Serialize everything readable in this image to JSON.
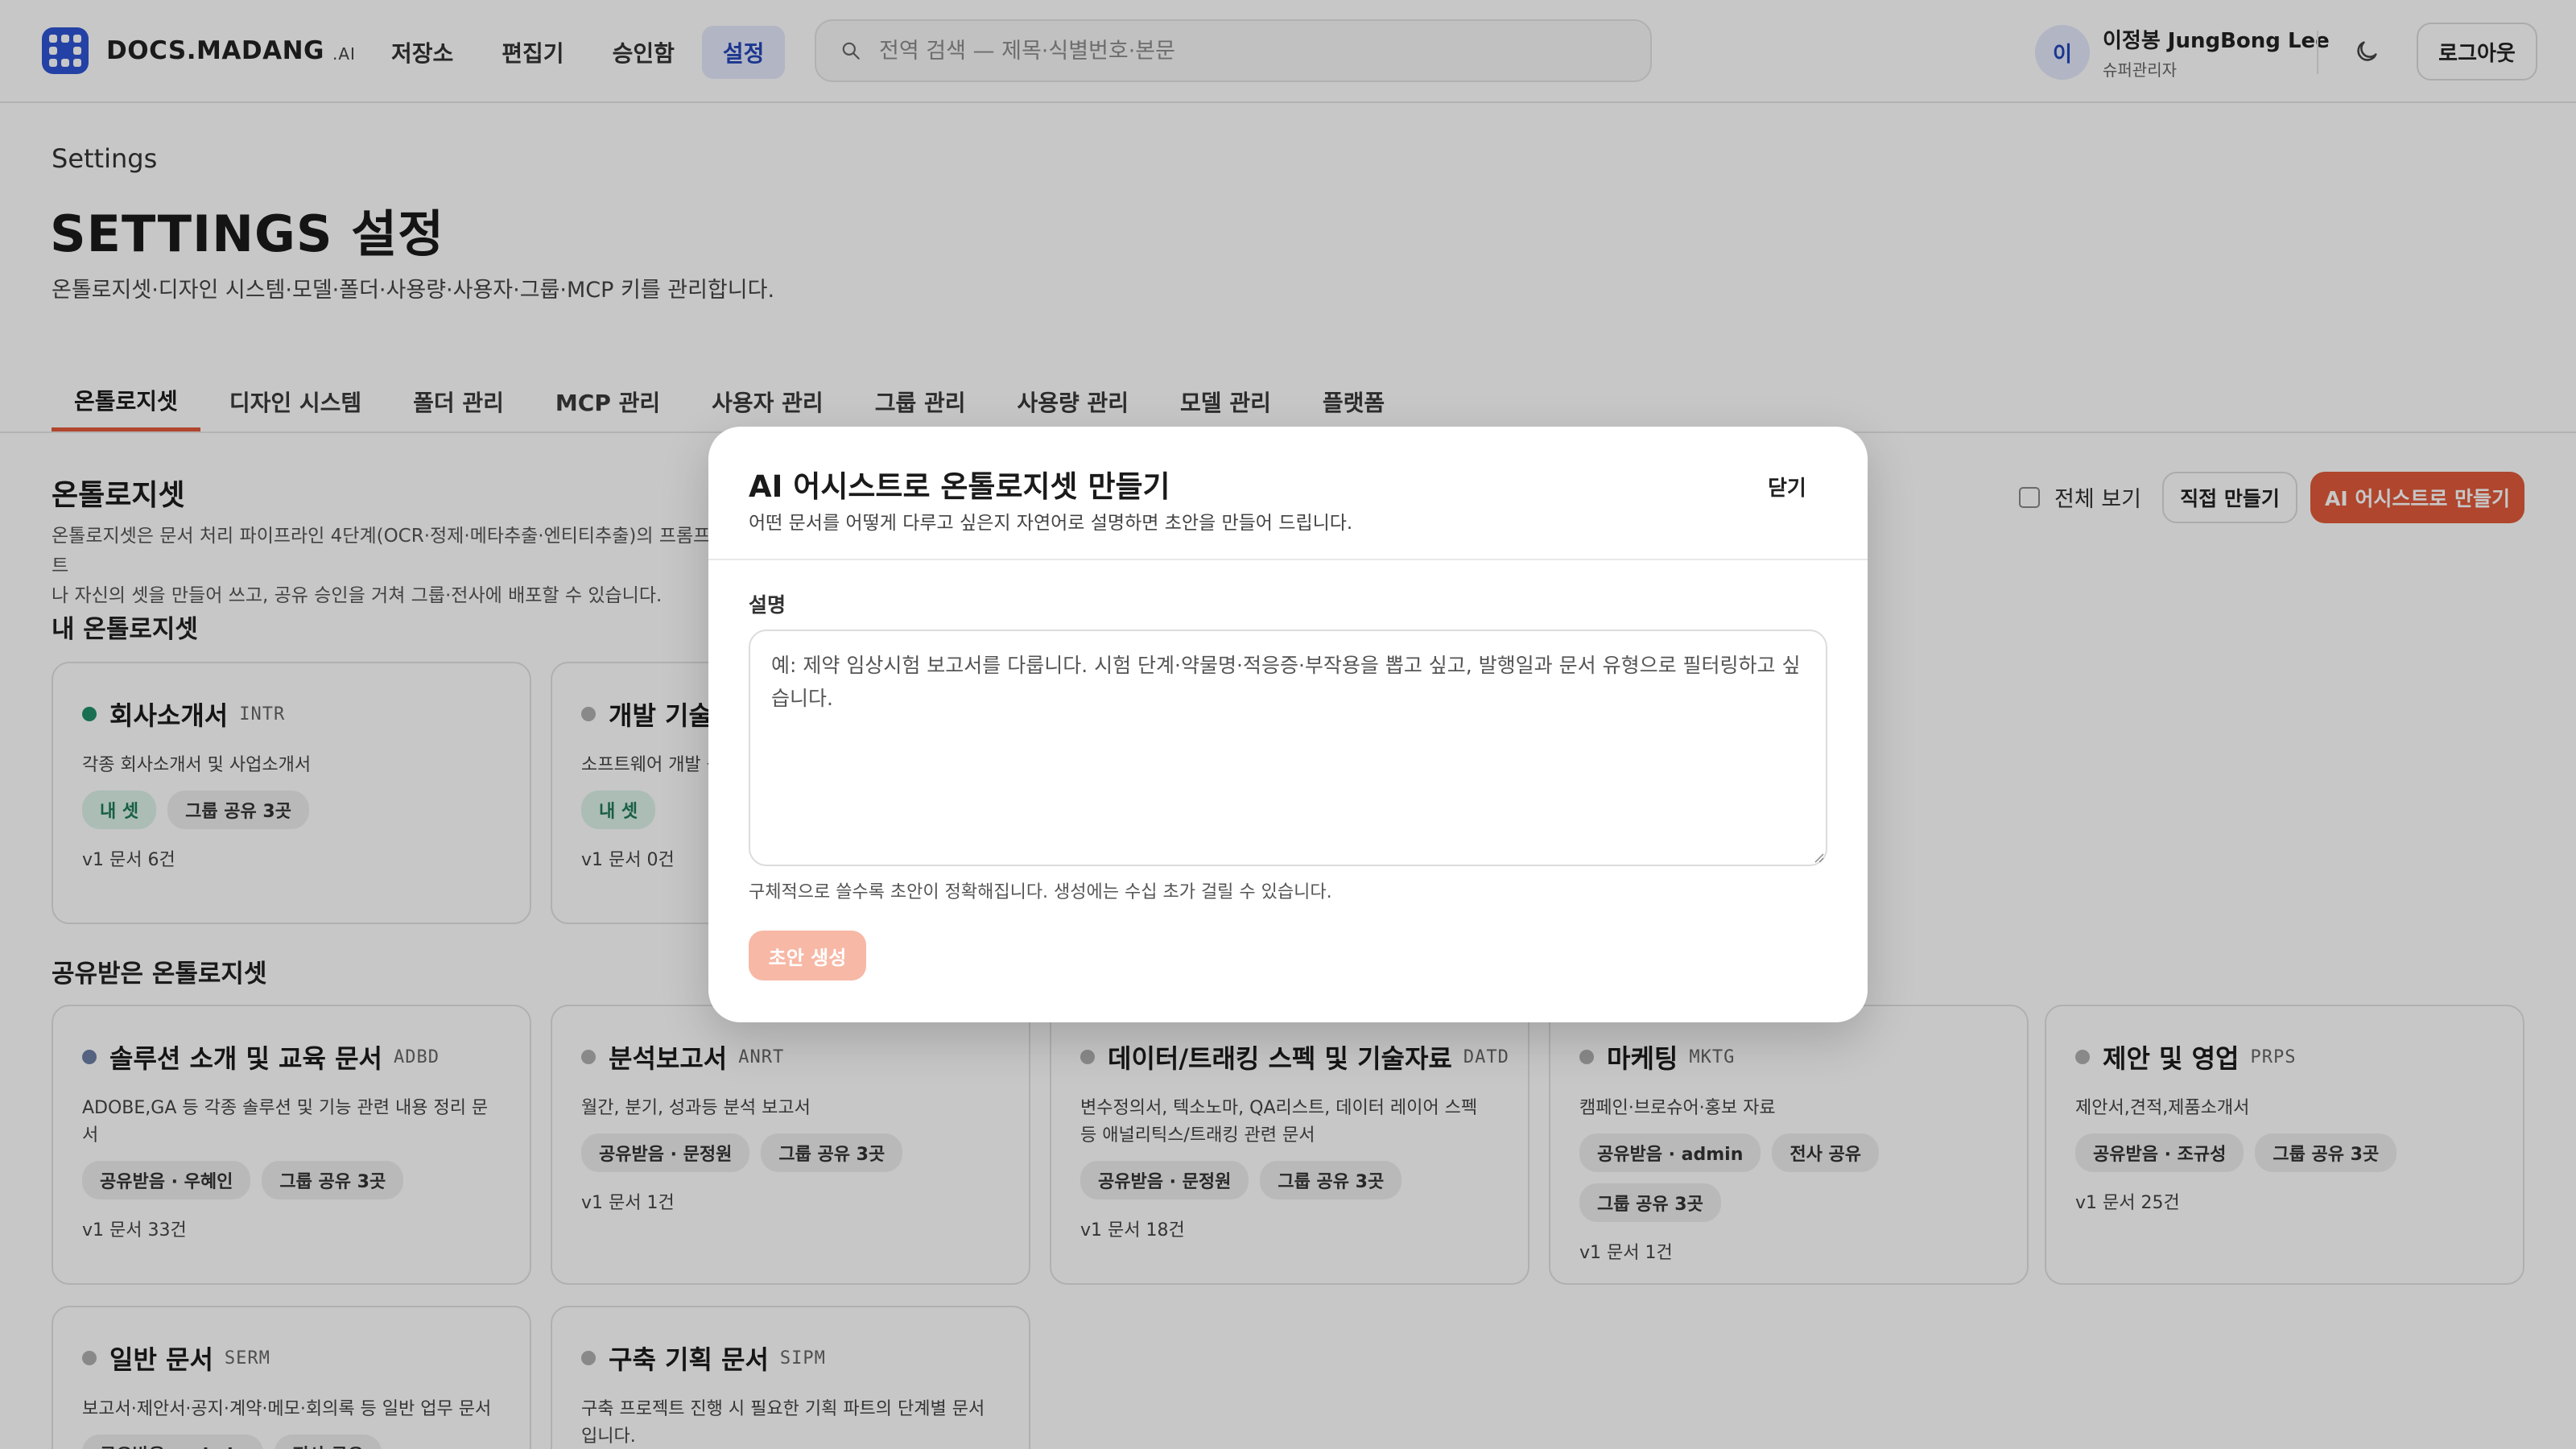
{
  "header": {
    "logo_text": "DOCS.MADANG",
    "logo_suffix": ".AI",
    "nav": [
      {
        "label": "저장소",
        "active": false
      },
      {
        "label": "편집기",
        "active": false
      },
      {
        "label": "승인함",
        "active": false
      },
      {
        "label": "설정",
        "active": true
      }
    ],
    "search_placeholder": "전역 검색 — 제목·식별번호·본문",
    "user": {
      "initial": "이",
      "name": "이정봉 JungBong Lee",
      "role": "슈퍼관리자"
    },
    "logout_label": "로그아웃"
  },
  "page": {
    "eyebrow": "Settings",
    "title": "SETTINGS 설정",
    "description": "온톨로지셋·디자인 시스템·모델·폴더·사용량·사용자·그룹·MCP 키를 관리합니다."
  },
  "tabs": [
    {
      "label": "온톨로지셋",
      "active": true
    },
    {
      "label": "디자인 시스템",
      "active": false
    },
    {
      "label": "폴더 관리",
      "active": false
    },
    {
      "label": "MCP 관리",
      "active": false
    },
    {
      "label": "사용자 관리",
      "active": false
    },
    {
      "label": "그룹 관리",
      "active": false
    },
    {
      "label": "사용량 관리",
      "active": false
    },
    {
      "label": "모델 관리",
      "active": false
    },
    {
      "label": "플랫폼",
      "active": false
    }
  ],
  "ontology": {
    "title": "온톨로지셋",
    "description": "온톨로지셋은 문서 처리 파이프라인 4단계(OCR·정제·메타추출·엔티티추출)의 프롬프트",
    "description2": "나 자신의 셋을 만들어 쓰고, 공유 승인을 거쳐 그룹·전사에 배포할 수 있습니다.",
    "show_all_label": "전체 보기",
    "manual_button": "직접 만들기",
    "ai_button": "AI 어시스트로 만들기",
    "my_title": "내 온톨로지셋",
    "shared_title": "공유받은 온톨로지셋",
    "my_cards": [
      {
        "name": "회사소개서",
        "code": "INTR",
        "dot": "green",
        "desc": "각종 회사소개서 및 사업소개서",
        "badges": [
          {
            "t": "내 셋",
            "s": "green"
          },
          {
            "t": "그룹 공유 3곳",
            "s": ""
          }
        ],
        "meta": "v1 문서 6건"
      },
      {
        "name": "개발 기술",
        "code": "",
        "dot": "gray",
        "desc": "소프트웨어 개발 등 기술 문서를 관",
        "badges": [
          {
            "t": "내 셋",
            "s": "green"
          }
        ],
        "meta": "v1 문서 0건"
      }
    ],
    "shared_cards": [
      {
        "name": "솔루션 소개 및 교육 문서",
        "code": "ADBD",
        "dot": "blue",
        "desc": "ADOBE,GA 등 각종 솔루션 및 기능 관련 내용 정리 문서",
        "badges": [
          {
            "t": "공유받음 · 우혜인",
            "s": ""
          },
          {
            "t": "그룹 공유 3곳",
            "s": ""
          }
        ],
        "meta": "v1 문서 33건"
      },
      {
        "name": "분석보고서",
        "code": "ANRT",
        "dot": "gray",
        "desc": "월간, 분기, 성과등 분석 보고서",
        "badges": [
          {
            "t": "공유받음 · 문정원",
            "s": ""
          },
          {
            "t": "그룹 공유 3곳",
            "s": ""
          }
        ],
        "meta": "v1 문서 1건"
      },
      {
        "name": "데이터/트래킹 스펙 및 기술자료",
        "code": "DATD",
        "dot": "gray",
        "desc": "변수정의서, 텍소노마, QA리스트, 데이터 레이어 스펙 등 애널리틱스/트래킹 관련 문서",
        "badges": [
          {
            "t": "공유받음 · 문정원",
            "s": ""
          },
          {
            "t": "그룹 공유 3곳",
            "s": ""
          }
        ],
        "meta": "v1 문서 18건"
      },
      {
        "name": "마케팅",
        "code": "MKTG",
        "dot": "gray",
        "desc": "캠페인·브로슈어·홍보 자료",
        "badges": [
          {
            "t": "공유받음 · admin",
            "s": ""
          },
          {
            "t": "전사 공유",
            "s": ""
          },
          {
            "t": "그룹 공유 3곳",
            "s": ""
          }
        ],
        "meta": "v1 문서 1건"
      },
      {
        "name": "제안 및 영업",
        "code": "PRPS",
        "dot": "gray",
        "desc": "제안서,견적,제품소개서",
        "badges": [
          {
            "t": "공유받음 · 조규성",
            "s": ""
          },
          {
            "t": "그룹 공유 3곳",
            "s": ""
          }
        ],
        "meta": "v1 문서 25건"
      },
      {
        "name": "일반 문서",
        "code": "SERM",
        "dot": "gray",
        "desc": "보고서·제안서·공지·계약·메모·회의록 등 일반 업무 문서",
        "badges": [
          {
            "t": "공유받음 · admin",
            "s": ""
          },
          {
            "t": "전사 공유",
            "s": ""
          }
        ],
        "meta": ""
      },
      {
        "name": "구축 기획 문서",
        "code": "SIPM",
        "dot": "gray",
        "desc": "구축 프로젝트 진행 시 필요한 기획 파트의 단계별 문서입니다.",
        "badges": [],
        "meta": ""
      }
    ]
  },
  "modal": {
    "title": "AI 어시스트로 온톨로지셋 만들기",
    "subtitle": "어떤 문서를 어떻게 다루고 싶은지 자연어로 설명하면 초안을 만들어 드립니다.",
    "close_label": "닫기",
    "field_label": "설명",
    "placeholder": "예: 제약 임상시험 보고서를 다룹니다. 시험 단계·약물명·적응증·부작용을 뽑고 싶고, 발행일과 문서 유형으로 필터링하고 싶습니다.",
    "help": "구체적으로 쓸수록 초안이 정확해집니다. 생성에는 수십 초가 걸릴 수 있습니다.",
    "generate_label": "초안 생성"
  }
}
